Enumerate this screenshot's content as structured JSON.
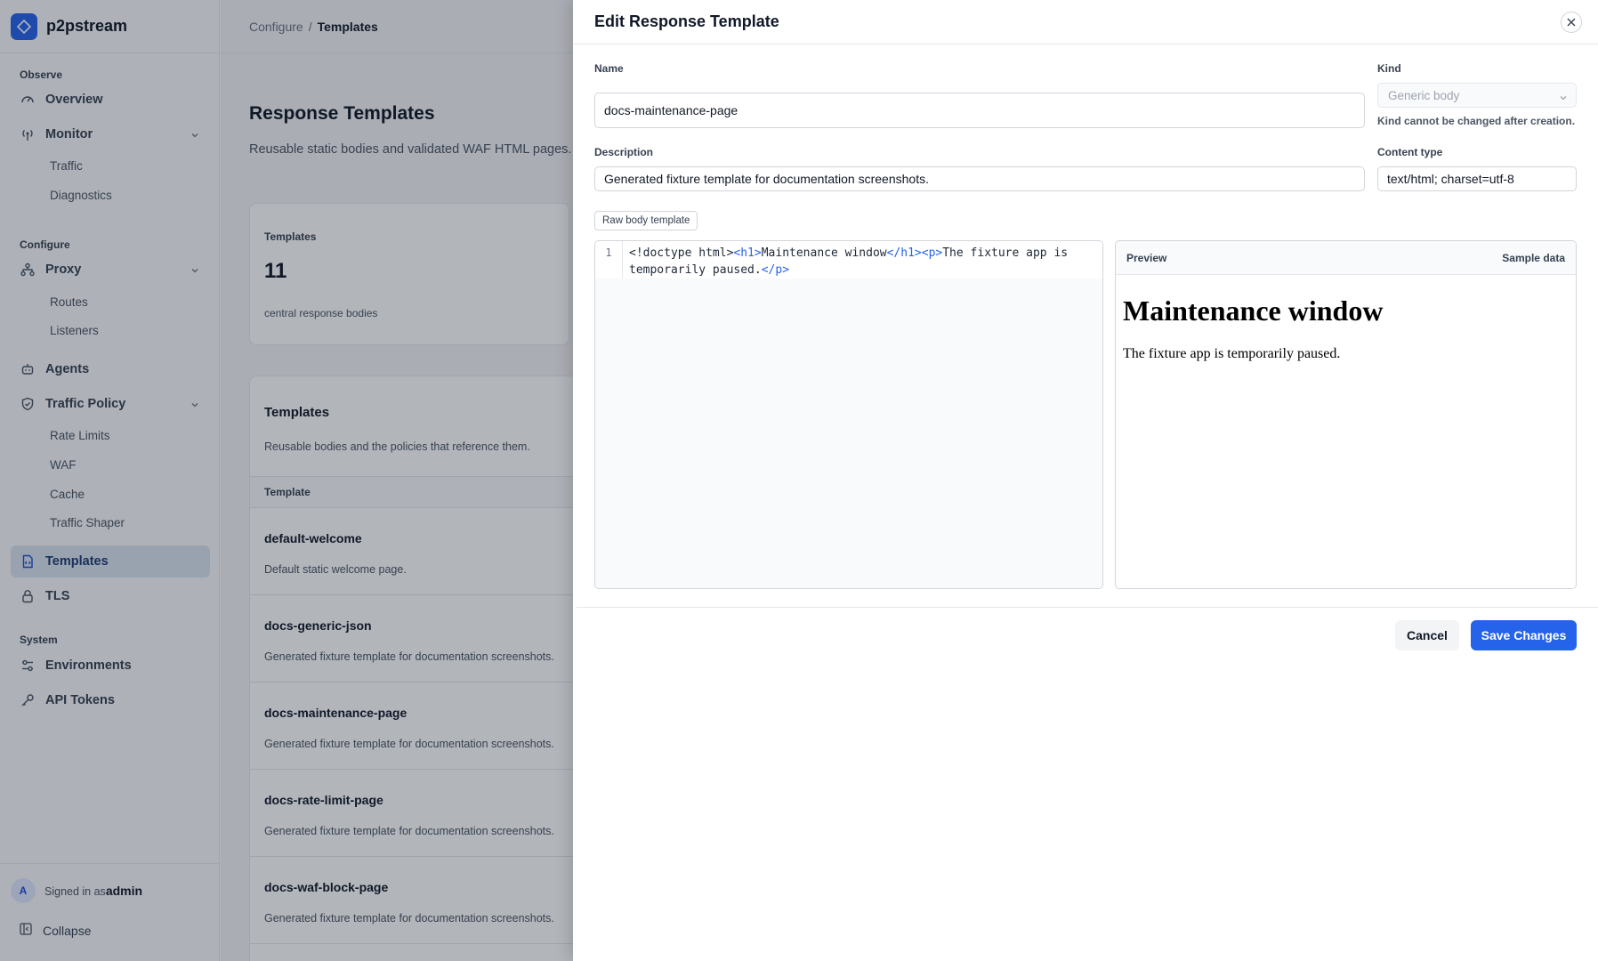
{
  "app": {
    "name": "p2pstream",
    "logo_icon": "diamond-icon"
  },
  "breadcrumb": {
    "parent": "Configure",
    "separator": "/",
    "current": "Templates"
  },
  "sidebar": {
    "sections": {
      "observe": "Observe",
      "configure": "Configure",
      "system": "System"
    },
    "items": {
      "overview": "Overview",
      "monitor": "Monitor",
      "traffic": "Traffic",
      "diagnostics": "Diagnostics",
      "proxy": "Proxy",
      "routes": "Routes",
      "listeners": "Listeners",
      "agents": "Agents",
      "traffic_policy": "Traffic Policy",
      "rate_limits": "Rate Limits",
      "waf": "WAF",
      "cache": "Cache",
      "traffic_shaper": "Traffic Shaper",
      "templates": "Templates",
      "tls": "TLS",
      "environments": "Environments",
      "api_tokens": "API Tokens"
    },
    "active": "templates",
    "footer": {
      "avatar_initial": "A",
      "signed_in_prefix": "Signed in as",
      "username": "admin",
      "collapse": "Collapse"
    }
  },
  "page": {
    "title": "Response Templates",
    "subtitle": "Reusable static bodies and validated WAF HTML pages.",
    "stat": {
      "label": "Templates",
      "value": "11",
      "sub": "central response bodies"
    },
    "list": {
      "title": "Templates",
      "subtitle": "Reusable bodies and the policies that reference them.",
      "column": "Template",
      "rows": [
        {
          "name": "default-welcome",
          "desc": "Default static welcome page."
        },
        {
          "name": "docs-generic-json",
          "desc": "Generated fixture template for documentation screenshots."
        },
        {
          "name": "docs-maintenance-page",
          "desc": "Generated fixture template for documentation screenshots."
        },
        {
          "name": "docs-rate-limit-page",
          "desc": "Generated fixture template for documentation screenshots."
        },
        {
          "name": "docs-waf-block-page",
          "desc": "Generated fixture template for documentation screenshots."
        }
      ]
    }
  },
  "drawer": {
    "title": "Edit Response Template",
    "name_label": "Name",
    "name_value": "docs-maintenance-page",
    "kind_label": "Kind",
    "kind_value": "Generic body",
    "kind_help": "Kind cannot be changed after creation.",
    "description_label": "Description",
    "description_value": "Generated fixture template for documentation screenshots.",
    "content_type_label": "Content type",
    "content_type_value": "text/html; charset=utf-8",
    "raw_body_button": "Raw body template",
    "editor": {
      "line_number": "1",
      "tokens": {
        "t1": "<!doctype html>",
        "t2": "<h1>",
        "t3": "Maintenance window",
        "t4": "</h1>",
        "t5": "<p>",
        "t6": "The fixture app is temporarily paused.",
        "t7": "</p>"
      }
    },
    "preview": {
      "label": "Preview",
      "sample_data": "Sample data",
      "heading": "Maintenance window",
      "paragraph": "The fixture app is temporarily paused."
    },
    "cancel": "Cancel",
    "save": "Save Changes"
  },
  "colors": {
    "accent": "#2563eb",
    "active_nav_bg": "#dbe3ef"
  }
}
